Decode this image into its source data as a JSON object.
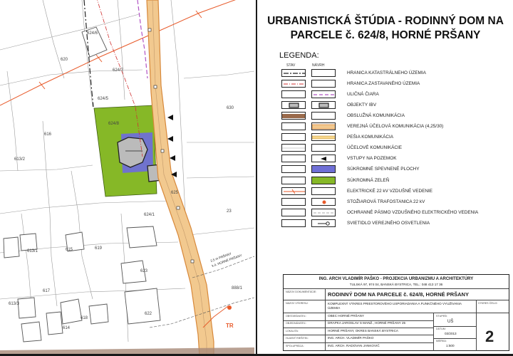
{
  "title": {
    "line1": "URBANISTICKÁ ŠTÚDIA - RODINNÝ DOM NA",
    "line2": "PARCELE č. 624/8, HORNÉ PRŠANY"
  },
  "legend": {
    "heading": "LEGENDA:",
    "col_existing": "STAV",
    "col_proposed": "NÁVRH",
    "items": [
      {
        "label": "HRANICA KATASTRÁLNEHO ÚZEMIA",
        "symbol": "cadastral-boundary"
      },
      {
        "label": "HRANICA ZASTAVANÉHO ÚZEMIA",
        "symbol": "built-up-boundary"
      },
      {
        "label": "ULIČNÁ ČIARA",
        "symbol": "street-line"
      },
      {
        "label": "OBJEKTY IBV",
        "symbol": "buildings"
      },
      {
        "label": "OBSLUŽNÁ KOMUNIKÁCIA",
        "symbol": "service-road"
      },
      {
        "label": "VEREJNÁ ÚČELOVÁ KOMUNIKÁCIA (4,25/30)",
        "symbol": "public-road"
      },
      {
        "label": "PEŠIA KOMUNIKÁCIA",
        "symbol": "footpath"
      },
      {
        "label": "ÚČELOVÉ KOMUNIKÁCIE",
        "symbol": "purpose-roads"
      },
      {
        "label": "VSTUPY NA POZEMOK",
        "symbol": "entrance-arrow"
      },
      {
        "label": "SÚKROMNÉ SPEVNENÉ PLOCHY",
        "symbol": "paved-area"
      },
      {
        "label": "SÚKROMNÁ ZELEŇ",
        "symbol": "private-green"
      },
      {
        "label": "ELEKTRICKÉ 22 kV VZDUŠNÉ VEDENIE",
        "symbol": "power-line"
      },
      {
        "label": "STOŽIAROVÁ TRAFOSTANICA 22 kV",
        "symbol": "transformer"
      },
      {
        "label": "OCHRANNÉ PÁSMO VZDUŠNÉHO ELEKTRICKÉHO VEDENIA",
        "symbol": "protection-zone"
      },
      {
        "label": "SVIETIDLO VEREJNÉHO OSVETLENIA",
        "symbol": "street-light"
      }
    ]
  },
  "title_block": {
    "company": "ING. ARCH VLADIMÍR PAŠKO - PROJEKCIA URBANIZMU A ARCHITEKTÚRY",
    "address": "TULSKÁ 97, 974 04, BANSKÁ BYSTRICA, TEL.: 048 413 17 36",
    "project_label": "NÁZOV DOKUMENTÁCIE:",
    "project": "RODINNÝ DOM NA PARCELE č. 624/8, HORNÉ PRŠANY",
    "drawing_label": "NÁZOV VÝKRESU:",
    "drawing": "KOMPLEXNÝ VÝKRES PRIESTOROVÉHO USPORIADANIA A FUNKČNÉHO VYUŽÍVANIA ÚZEMIA",
    "rows": [
      {
        "label": "OBSTARÁVATEĽ:",
        "value": "OBEC HORNÉ PRŠANY"
      },
      {
        "label": "OBJEDNÁVATEĽ:",
        "value": "DRAPKA JAROSLAV S MANŽ., HORNÉ PRŠANY 25"
      },
      {
        "label": "LOKALITA:",
        "value": "HORNÉ PRŠANY, OKRES BANSKÁ BYSTRICA"
      },
      {
        "label": "HLAVNÝ RIEŠITEĽ:",
        "value": "ING. ARCH. VLADIMÍR PAŠKO"
      },
      {
        "label": "SPOLUPRÁCA:",
        "value": "ING. ARCH. RADOVAN JANKOVIČ"
      }
    ],
    "stage_label": "STUPEŇ:",
    "stage": "UŠ",
    "date_label": "DÁTUM:",
    "date": "03/2013",
    "scale_label": "MIERKA:",
    "scale": "1:500",
    "sheet_label": "VÝKRES ČÍSLO:",
    "sheet": "2"
  },
  "map": {
    "parcels": [
      "624/6",
      "620",
      "624/7",
      "624/5",
      "624/8",
      "616",
      "613/2",
      "630",
      "624/1",
      "625",
      "615",
      "619",
      "613/1",
      "623",
      "617",
      "613/3",
      "618",
      "614",
      "622",
      "888/1",
      "23"
    ],
    "road_labels": [
      "2,5 m PRŠANY",
      "k.ú. HORNÉ PRŠANY"
    ],
    "transformer_label": "TR"
  },
  "colors": {
    "green": "#86b827",
    "paved": "#6f6fd6",
    "road": "#f2c98f",
    "road_edge": "#d7883a",
    "power": "#e85a2a",
    "street_line": "#b053c4",
    "service": "#9a6a4b"
  }
}
